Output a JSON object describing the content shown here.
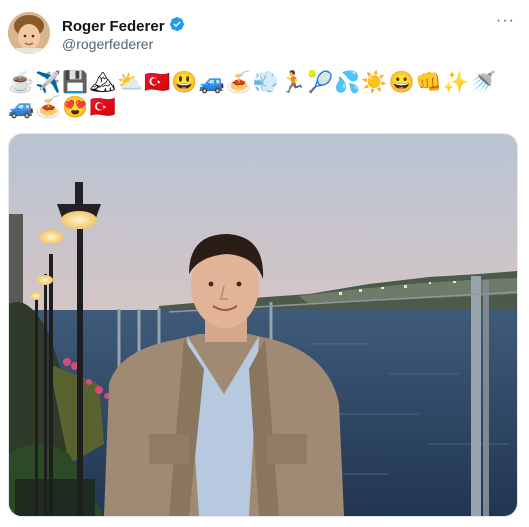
{
  "tweet": {
    "display_name": "Roger Federer",
    "handle": "@rogerfederer",
    "verified": true,
    "more_label": "···",
    "emoji_line1": "☕✈️💾🏔⛅🇹🇷😃🚙🍝💨🏃🎾💦☀️😀👊✨🚿",
    "emoji_line2": "🚙🍝😍🇹🇷"
  },
  "colors": {
    "verified_blue": "#1d9bf0",
    "handle_gray": "#536471"
  },
  "icons": [
    "verified-badge-icon",
    "more-options-icon"
  ]
}
